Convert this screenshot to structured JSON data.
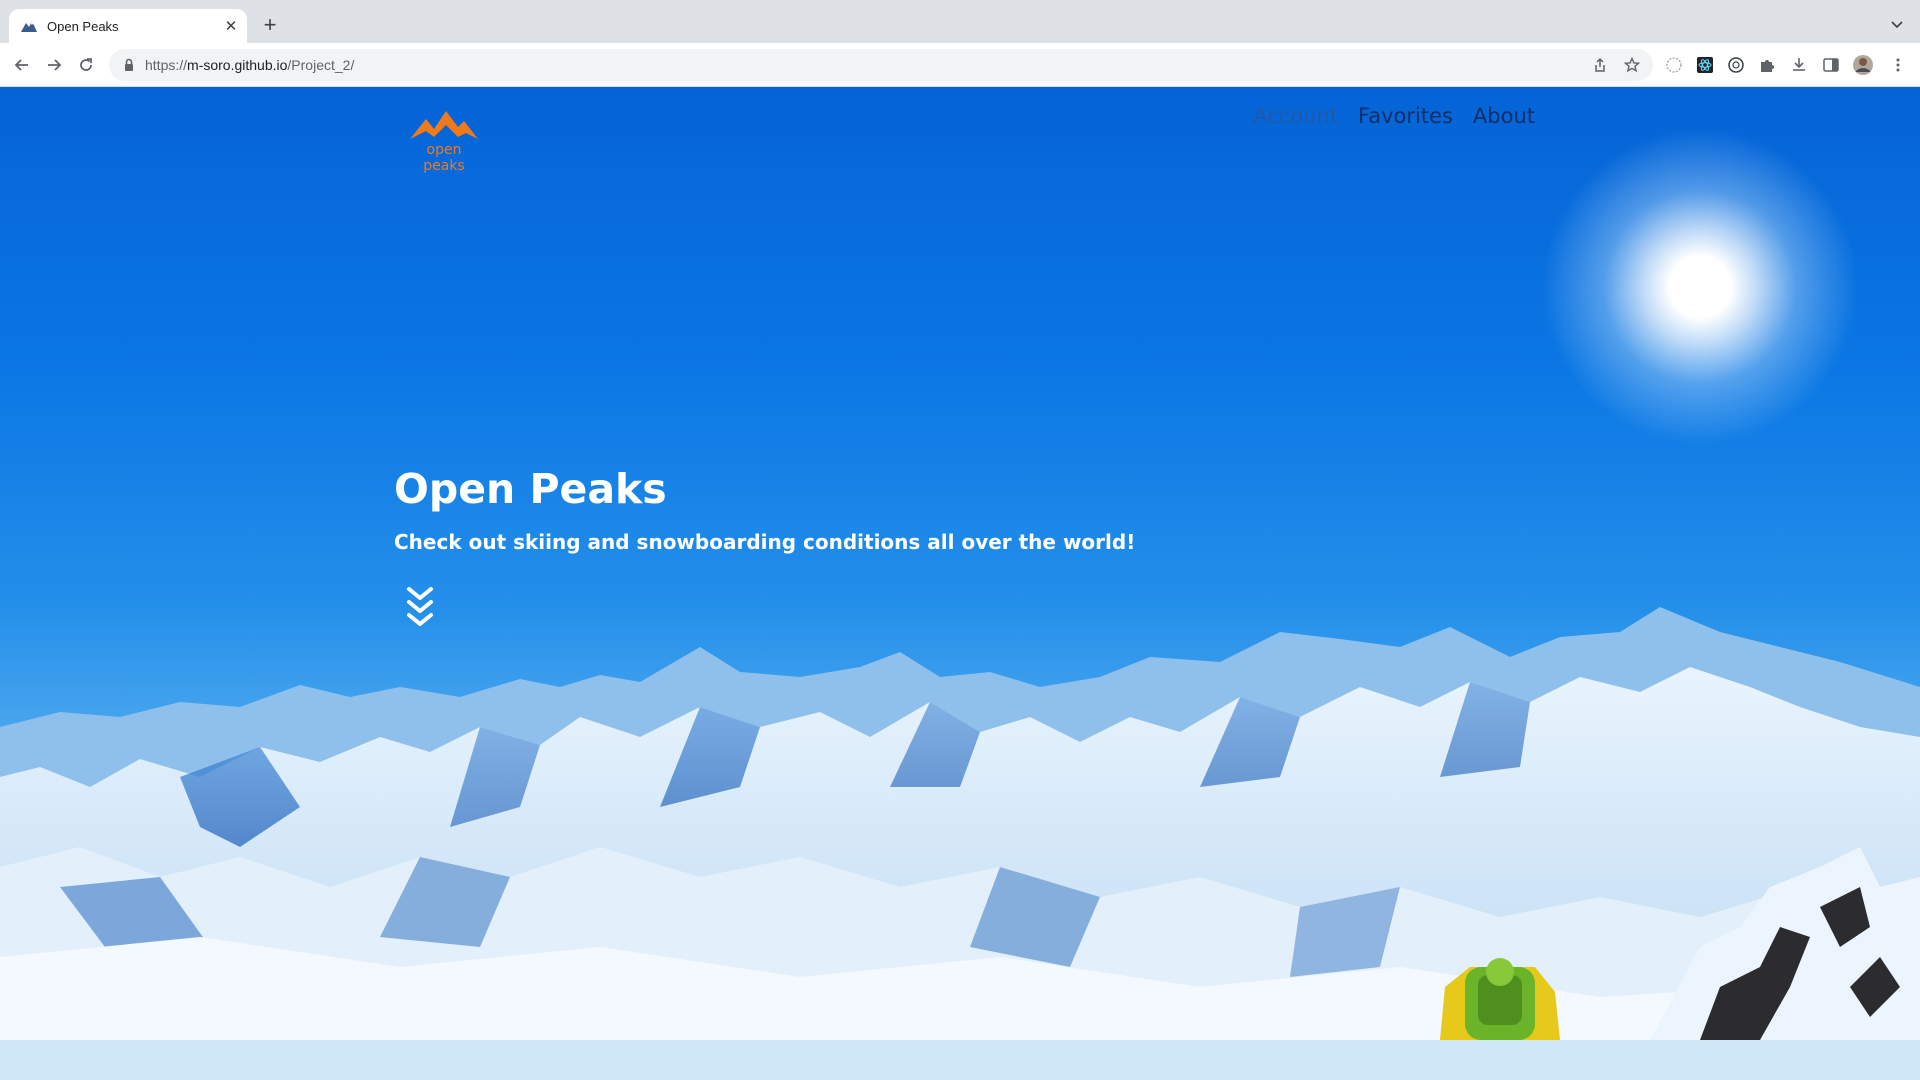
{
  "browser": {
    "tab": {
      "title": "Open Peaks"
    },
    "url": {
      "prefix": "https://",
      "host": "m-soro.github.io",
      "path": "/Project_2/"
    }
  },
  "site": {
    "logo_text": "open peaks",
    "nav": [
      {
        "label": "Account"
      },
      {
        "label": "Favorites"
      },
      {
        "label": "About"
      }
    ],
    "hero": {
      "title": "Open Peaks",
      "subtitle": "Check out skiing and snowboarding conditions all over the world!"
    }
  },
  "icons": {
    "tab_favicon": "mountain-icon",
    "tab_close": "close-icon",
    "new_tab": "plus-icon",
    "tab_search": "chevron-down-icon",
    "back": "arrow-left-icon",
    "forward": "arrow-right-icon",
    "reload": "reload-icon",
    "lock": "lock-icon",
    "share": "share-icon",
    "bookmark": "star-icon",
    "extensions": [
      "moon-extension-icon",
      "react-devtools-icon",
      "openai-icon",
      "puzzle-icon"
    ],
    "download": "download-icon",
    "side_panel": "side-panel-icon",
    "profile": "avatar",
    "menu": "kebab-menu-icon",
    "scroll": "chevron-double-down-icon"
  },
  "colors": {
    "logo_orange": "#f07a1a",
    "nav_text": "#0b2f66",
    "sky_top": "#0563d6"
  }
}
